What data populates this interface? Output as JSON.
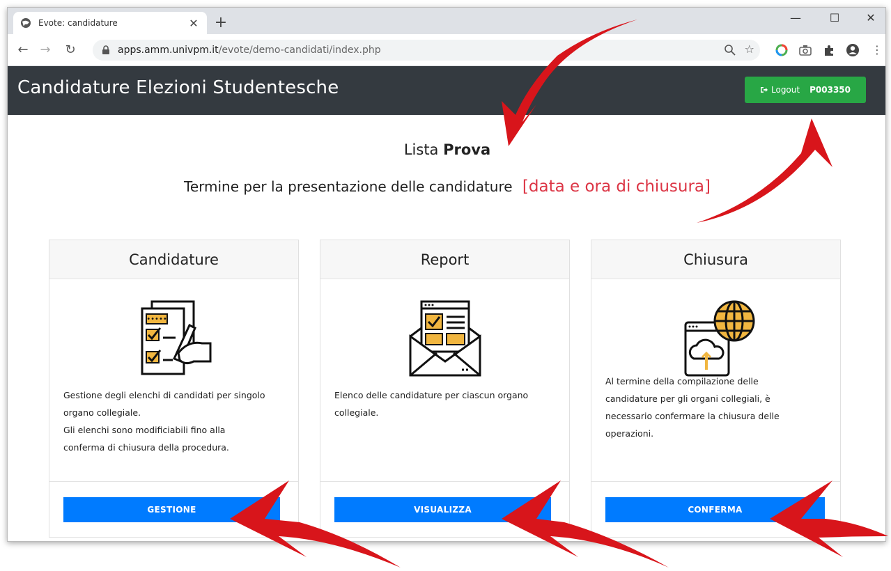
{
  "browser": {
    "tab_title": "Evote: candidature",
    "url_host": "apps.amm.univpm.it",
    "url_path": "/evote/demo-candidati/index.php"
  },
  "app": {
    "brand": "Candidature Elezioni Studentesche",
    "logout_label": "Logout",
    "user_code": "P003350"
  },
  "heading": {
    "list_prefix": "Lista",
    "list_name": "Prova",
    "deadline_label": "Termine per la presentazione delle candidature",
    "deadline_value": "[data e ora di chiusura]"
  },
  "cards": [
    {
      "title": "Candidature",
      "lines": [
        "Gestione degli elenchi di candidati per singolo",
        "organo collegiale.",
        "Gli elenchi sono modificiabili fino alla",
        "conferma di chiusura della procedura."
      ],
      "button": "GESTIONE"
    },
    {
      "title": "Report",
      "lines": [
        "Elenco delle candidature per ciascun organo",
        "collegiale."
      ],
      "button": "VISUALIZZA"
    },
    {
      "title": "Chiusura",
      "lines": [
        "Al termine della compilazione delle",
        "candidature per gli organi collegiali, è",
        "necessario confermare la chiusura delle",
        "operazioni."
      ],
      "button": "CONFERMA"
    }
  ],
  "colors": {
    "navbar": "#343a40",
    "logout_green": "#28a745",
    "primary_blue": "#007bff",
    "deadline_red": "#dc3545",
    "annotation_red": "#d8151b",
    "icon_yellow": "#f1b640"
  }
}
